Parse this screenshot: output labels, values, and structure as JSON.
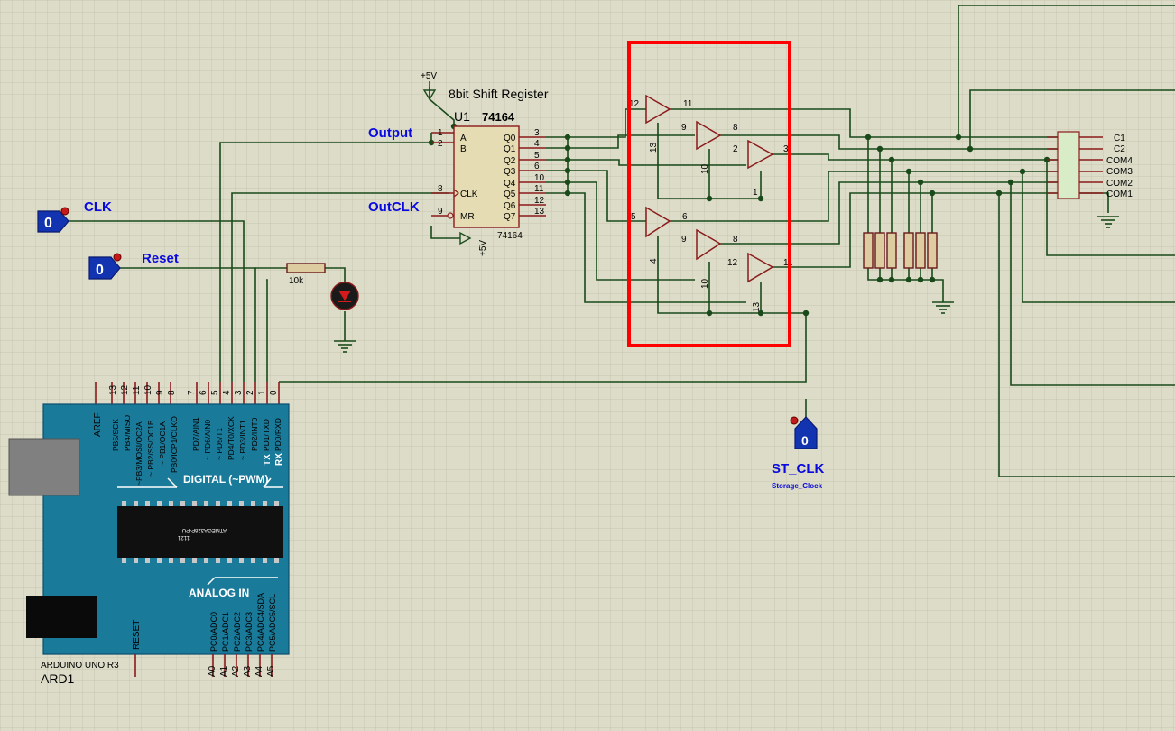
{
  "shift_register": {
    "title": "8bit Shift Register",
    "ref": "U1",
    "part": "74164",
    "part_bottom": "74164",
    "power": "+5V",
    "power_mr": "+5V",
    "pins_left": [
      {
        "num": "1",
        "name": "A"
      },
      {
        "num": "2",
        "name": "B"
      },
      {
        "num": "8",
        "name": "CLK"
      },
      {
        "num": "9",
        "name": "MR"
      }
    ],
    "pins_right": [
      {
        "num": "3",
        "name": "Q0"
      },
      {
        "num": "4",
        "name": "Q1"
      },
      {
        "num": "5",
        "name": "Q2"
      },
      {
        "num": "6",
        "name": "Q3"
      },
      {
        "num": "10",
        "name": "Q4"
      },
      {
        "num": "11",
        "name": "Q5"
      },
      {
        "num": "12",
        "name": "Q6"
      },
      {
        "num": "13",
        "name": "Q7"
      }
    ]
  },
  "net_labels": {
    "output": "Output",
    "outclk": "OutCLK"
  },
  "inputs": [
    {
      "name": "CLK",
      "state": "0"
    },
    {
      "name": "Reset",
      "state": "0"
    },
    {
      "name": "ST_CLK",
      "state": "0",
      "sublabel": "Storage_Clock"
    }
  ],
  "resistor": {
    "value": "10k"
  },
  "buffers": {
    "top": [
      "12",
      "11",
      "13",
      "9",
      "8",
      "10",
      "2",
      "3",
      "1"
    ],
    "bottom": [
      "5",
      "6",
      "4",
      "9",
      "8",
      "10",
      "12",
      "11",
      "13"
    ]
  },
  "display": {
    "pins": [
      "C1",
      "C2",
      "COM4",
      "COM3",
      "COM2",
      "COM1"
    ]
  },
  "arduino": {
    "name": "ARDUINO UNO R3",
    "ref": "ARD1",
    "digital_label": "DIGITAL (~PWM)",
    "analog_label": "ANALOG IN",
    "chip_label": "ATMEGA328P-PU",
    "chip_sub": "1121",
    "aref": "AREF",
    "reset": "RESET",
    "tx": "TX",
    "rx": "RX",
    "digital_pins": [
      "13",
      "12",
      "11",
      "10",
      "9",
      "8",
      "7",
      "6",
      "5",
      "4",
      "3",
      "2",
      "1",
      "0"
    ],
    "digital_names": [
      "PB5/SCK",
      "PB4/MISO",
      "~PB3/MOSI/OC2A",
      "~ PB2/SS/OC1B",
      "~ PB1/OC1A",
      "PB0/ICP1/CLKO",
      "PD7/AIN1",
      "~ PD6/AIN0",
      "~ PD5/T1",
      "PD4/T0/XCK",
      "~ PD3/INT1",
      "PD2/INT0",
      "PD1/TXD",
      "PD0/RXD"
    ],
    "analog_pins": [
      "A0",
      "A1",
      "A2",
      "A3",
      "A4",
      "A5"
    ],
    "analog_names": [
      "PC0/ADC0",
      "PC1/ADC1",
      "PC2/ADC2",
      "PC3/ADC3",
      "PC4/ADC4/SDA",
      "PC5/ADC5/SCL"
    ]
  },
  "highlight_color": "#ff0000",
  "wire_color": "#1a4a1a",
  "arduino_color": "#1a7a9a"
}
